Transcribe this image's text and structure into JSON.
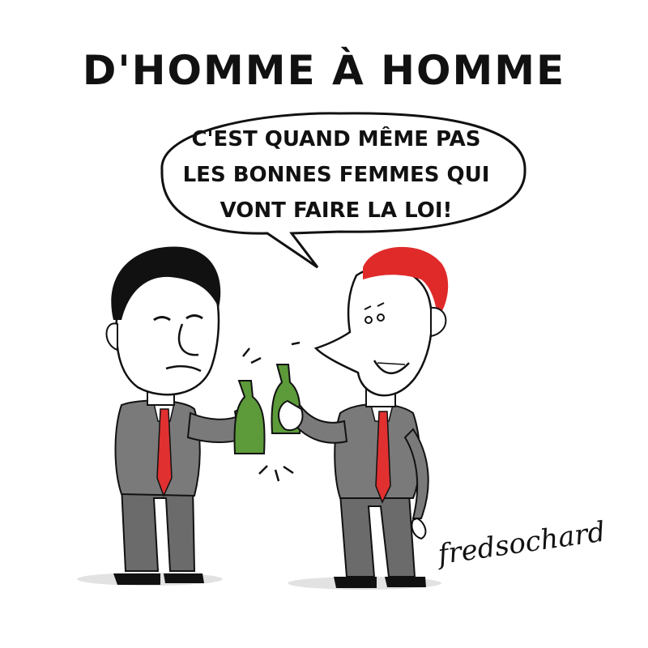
{
  "cartoon": {
    "title": "D'HOMME À HOMME",
    "speech_bubble": {
      "lines": [
        "C'EST QUAND MÊME PAS",
        "LES BONNES FEMMES QUI",
        "VONT FAIRE LA LOI!"
      ]
    },
    "signature": "fredsochard",
    "colors": {
      "ink": "#111111",
      "red_hair": "#e02a2a",
      "tie": "#e03030",
      "bottle": "#5c9a3a",
      "suit_shade": "#6b6b6b",
      "skin": "#ffffff"
    }
  }
}
